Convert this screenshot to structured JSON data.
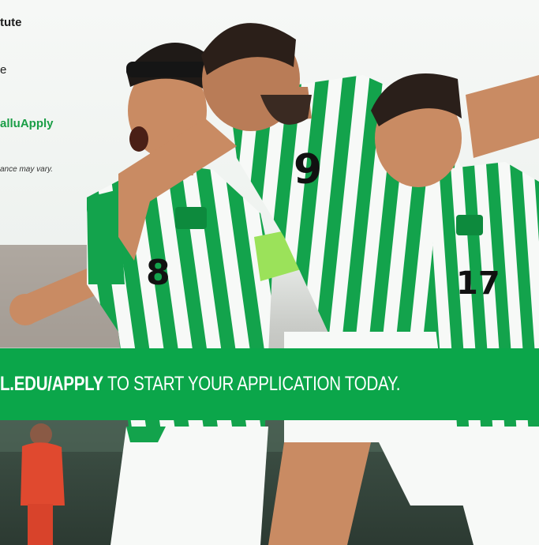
{
  "text": {
    "line1": "tute",
    "line2": "e",
    "line3": "alluApply",
    "line4": "ance may vary."
  },
  "banner": {
    "bold": "L.EDU/APPLY",
    "rest": " TO START YOUR APPLICATION TODAY."
  },
  "colors": {
    "brand_green": "#0ba64a",
    "link_green": "#1a9e46",
    "jersey_green": "#13a34c",
    "jersey_white": "#f7f9f7"
  },
  "jersey_numbers": [
    "8",
    "9",
    "17"
  ]
}
